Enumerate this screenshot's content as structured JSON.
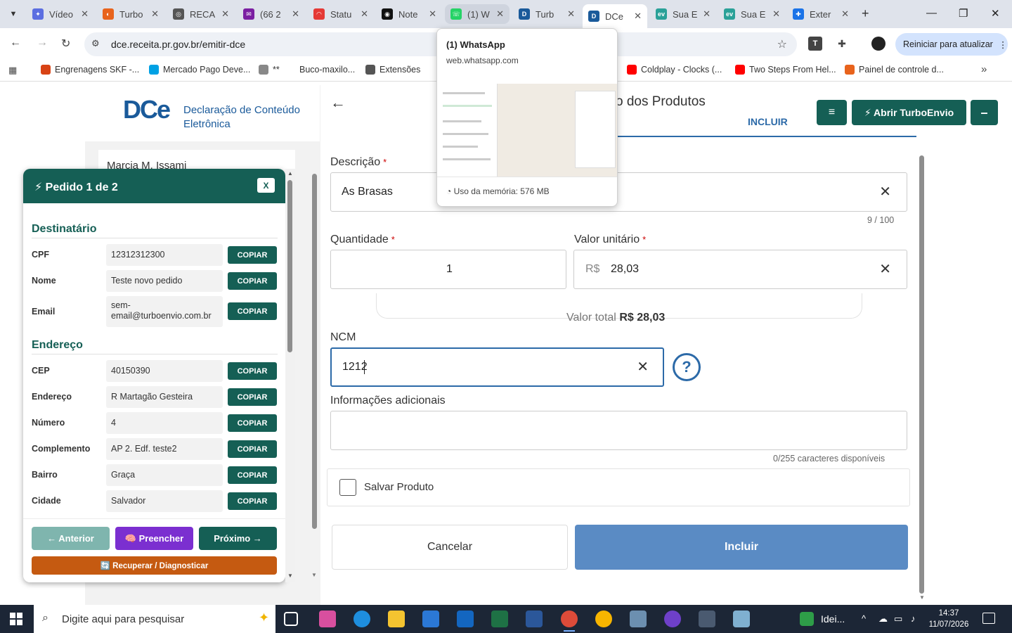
{
  "browser": {
    "tabs": [
      {
        "title": "Vídeo",
        "color": "#5b6ee1",
        "glyph": "✦"
      },
      {
        "title": "Turbo",
        "color": "#e8631c",
        "glyph": "◐"
      },
      {
        "title": "RECA",
        "color": "#555555",
        "glyph": "◎"
      },
      {
        "title": "(66 2",
        "color": "#7b1fa2",
        "glyph": "✉"
      },
      {
        "title": "Statu",
        "color": "#e53935",
        "glyph": "◠"
      },
      {
        "title": "Note",
        "color": "#111111",
        "glyph": "◉"
      },
      {
        "title": "(1) W",
        "color": "#25d366",
        "glyph": "☏"
      },
      {
        "title": "Turb",
        "color": "#1a5a9a",
        "glyph": "D"
      },
      {
        "title": "DCe",
        "color": "#1a5a9a",
        "glyph": "D"
      },
      {
        "title": "Sua E",
        "color": "#2aa198",
        "glyph": "ev"
      },
      {
        "title": "Sua E",
        "color": "#2aa198",
        "glyph": "ev"
      },
      {
        "title": "Exter",
        "color": "#1a73e8",
        "glyph": "✚"
      }
    ],
    "url": "dce.receita.pr.gov.br/emitir-dce",
    "update_label": "Reiniciar para atualizar",
    "bookmarks": [
      {
        "label": "Engrenagens SKF -...",
        "color": "#d84315"
      },
      {
        "label": "Mercado Pago Deve...",
        "color": "#00a1e4"
      },
      {
        "label": "**",
        "color": "#888888"
      },
      {
        "label": "Buco-maxilo...",
        "color": "#ffffff"
      },
      {
        "label": "Extensões",
        "color": "#555555"
      },
      {
        "label": "Coldplay - Clocks (...",
        "color": "#ff0000"
      },
      {
        "label": "Two Steps From Hel...",
        "color": "#ff0000"
      },
      {
        "label": "Painel de controle d...",
        "color": "#e8631c"
      }
    ]
  },
  "hovercard": {
    "title": "(1) WhatsApp",
    "url": "web.whatsapp.com",
    "memory": "Uso da memória: 576 MB"
  },
  "dce": {
    "logo_mark": "DCe",
    "logo_line1": "Declaração de Conteúdo",
    "logo_line2": "Eletrônica",
    "user_name": "Marcia M. Issami",
    "section_title": "o dos Produtos",
    "tab_label": "INCLUIR",
    "descricao_label": "Descrição",
    "descricao_value": "As Brasas",
    "descricao_counter": "9 / 100",
    "quantidade_label": "Quantidade",
    "quantidade_value": "1",
    "valor_label": "Valor unitário",
    "valor_prefix": "R$",
    "valor_value": "28,03",
    "total_label": "Valor total",
    "total_value": "R$ 28,03",
    "ncm_label": "NCM",
    "ncm_value": "1212",
    "help": "?",
    "info_label": "Informações adicionais",
    "info_counter": "0/255 caracteres disponíveis",
    "save_label": "Salvar Produto",
    "cancel_label": "Cancelar",
    "submit_label": "Incluir",
    "required_mark": "*"
  },
  "turbo": {
    "menu_glyph": "≡",
    "open_label": "⚡ Abrir TurboEnvio",
    "min_glyph": "–"
  },
  "pedido": {
    "title": "⚡ Pedido 1 de 2",
    "close": "X",
    "copy_label": "COPIAR",
    "destinatario_title": "Destinatário",
    "destinatario": [
      {
        "label": "CPF",
        "value": "12312312300"
      },
      {
        "label": "Nome",
        "value": "Teste novo pedido"
      },
      {
        "label": "Email",
        "value": "sem-email@turboenvio.com.br"
      }
    ],
    "endereco_title": "Endereço",
    "endereco": [
      {
        "label": "CEP",
        "value": "40150390"
      },
      {
        "label": "Endereço",
        "value": "R Martagão Gesteira"
      },
      {
        "label": "Número",
        "value": "4"
      },
      {
        "label": "Complemento",
        "value": "AP 2. Edf. teste2"
      },
      {
        "label": "Bairro",
        "value": "Graça"
      },
      {
        "label": "Cidade",
        "value": "Salvador"
      }
    ],
    "prev_label": "← Anterior",
    "fill_label": "🧠 Preencher",
    "next_label": "Próximo →",
    "recover_label": "🔄 Recuperar / Diagnosticar",
    "colors": {
      "prev": "#7fb5ae",
      "fill": "#7b2fd0",
      "next": "#155f55",
      "recover": "#c55a11"
    }
  },
  "taskbar": {
    "search_placeholder": "Digite aqui para pesquisar",
    "app_label": "Idei...",
    "time": "14:37",
    "date": "11/07/2026"
  }
}
